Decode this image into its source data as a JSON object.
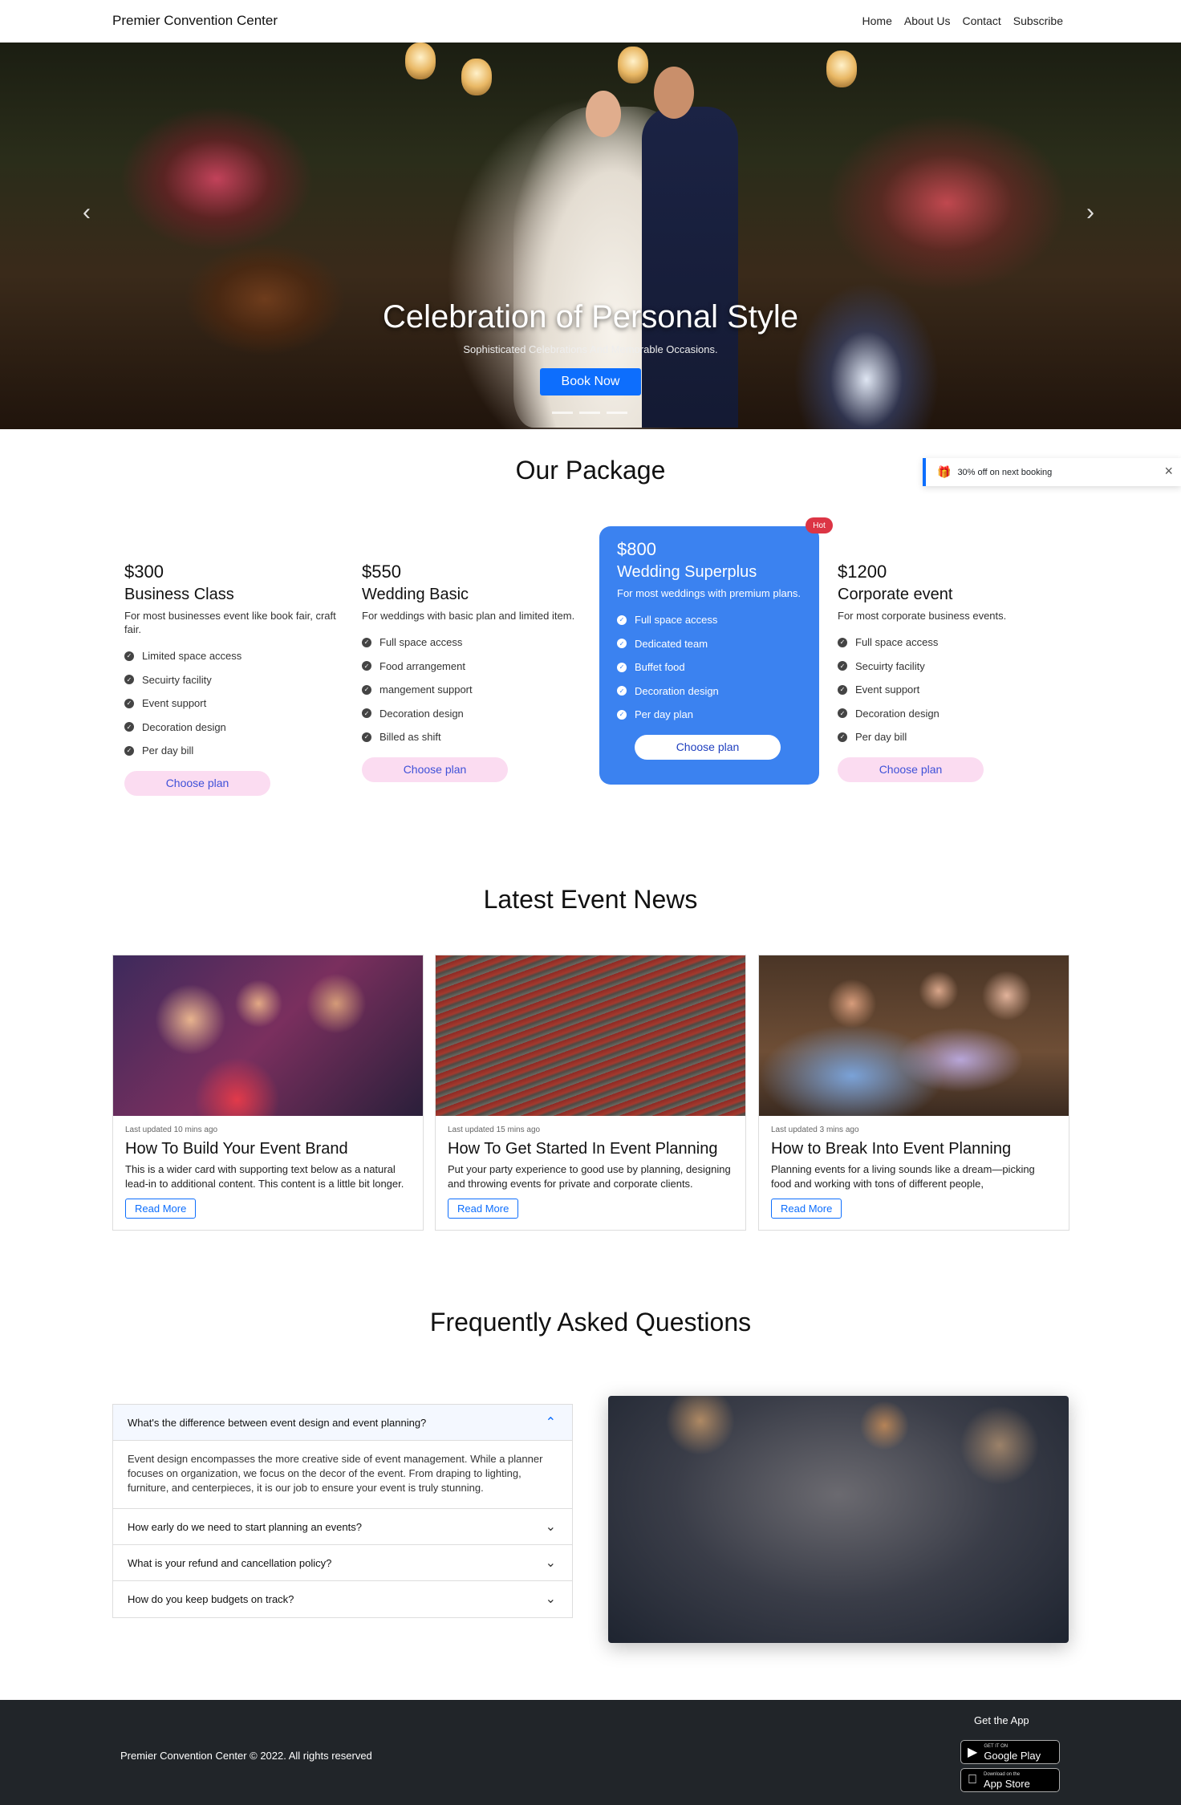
{
  "nav": {
    "brand": "Premier Convention Center",
    "links": [
      "Home",
      "About Us",
      "Contact",
      "Subscribe"
    ]
  },
  "hero": {
    "title": "Celebration of Personal Style",
    "subtitle": "Sophisticated Celebrations And Memorable Occasions.",
    "button": "Book Now",
    "prev_icon": "chevron-left-icon",
    "next_icon": "chevron-right-icon"
  },
  "packages": {
    "heading": "Our Package",
    "hot_badge": "Hot",
    "plans": [
      {
        "price": "$300",
        "name": "Business Class",
        "desc": "For most businesses event like book fair, craft fair.",
        "features": [
          "Limited space access",
          "Secuirty facility",
          "Event support",
          "Decoration design",
          "Per day bill"
        ],
        "button": "Choose plan"
      },
      {
        "price": "$550",
        "name": "Wedding Basic",
        "desc": "For weddings with basic plan and limited item.",
        "features": [
          "Full space access",
          "Food arrangement",
          "mangement support",
          "Decoration design",
          "Billed as shift"
        ],
        "button": "Choose plan"
      },
      {
        "price": "$800",
        "name": "Wedding Superplus",
        "desc": "For most weddings with premium plans.",
        "features": [
          "Full space access",
          "Dedicated team",
          "Buffet food",
          "Decoration design",
          "Per day plan"
        ],
        "button": "Choose plan"
      },
      {
        "price": "$1200",
        "name": "Corporate event",
        "desc": "For most corporate business events.",
        "features": [
          "Full space access",
          "Secuirty facility",
          "Event support",
          "Decoration design",
          "Per day bill"
        ],
        "button": "Choose plan"
      }
    ]
  },
  "toast": {
    "text": "30% off on next booking",
    "icon": "gift-icon",
    "close": "×"
  },
  "news": {
    "heading": "Latest Event News",
    "cards": [
      {
        "updated": "Last updated 10 mins ago",
        "title": "How To Build Your Event Brand",
        "text": "This is a wider card with supporting text below as a natural lead-in to additional content. This content is a little bit longer.",
        "button": "Read More"
      },
      {
        "updated": "Last updated 15 mins ago",
        "title": "How To Get Started In Event Planning",
        "text": "Put your party experience to good use by planning, designing and throwing events for private and corporate clients.",
        "button": "Read More"
      },
      {
        "updated": "Last updated 3 mins ago",
        "title": "How to Break Into Event Planning",
        "text": "Planning events for a living sounds like a dream—picking food and working with tons of different people,",
        "button": "Read More"
      }
    ]
  },
  "faq": {
    "heading": "Frequently Asked Questions",
    "items": [
      {
        "q": "What's the difference between event design and event planning?",
        "a": "Event design encompasses the more creative side of event management. While a planner focuses on organization, we focus on the decor of the event. From draping to lighting, furniture, and centerpieces, it is our job to ensure your event is truly stunning."
      },
      {
        "q": "How early do we need to start planning an events?"
      },
      {
        "q": "What is your refund and cancellation policy?"
      },
      {
        "q": "How do you keep budgets on track?"
      }
    ]
  },
  "footer": {
    "copyright": "Premier Convention Center © 2022. All rights reserved",
    "get_app": "Get the App",
    "google_small": "GET IT ON",
    "google": "Google Play",
    "apple_small": "Download on the",
    "apple": "App Store"
  }
}
